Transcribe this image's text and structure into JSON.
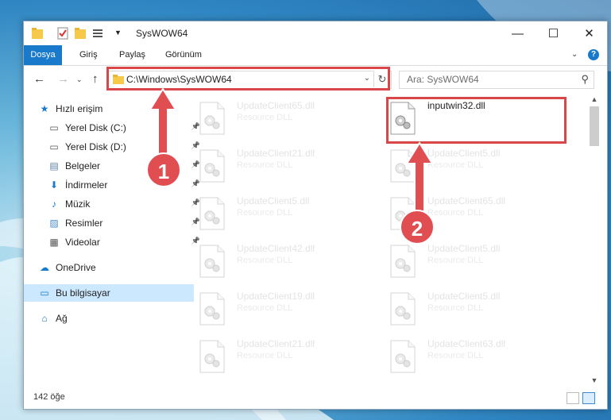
{
  "window": {
    "title": "SysWOW64"
  },
  "window_controls": {
    "minimize": "—",
    "maximize": "☐",
    "close": "✕"
  },
  "ribbon": {
    "tabs": [
      "Dosya",
      "Giriş",
      "Paylaş",
      "Görünüm"
    ],
    "help": "?"
  },
  "address": {
    "path": "C:\\Windows\\SysWOW64",
    "search_placeholder": "Ara: SysWOW64"
  },
  "nav": {
    "items": [
      {
        "label": "Hızlı erişim",
        "icon": "star-icon",
        "pinned": false
      },
      {
        "label": "Yerel Disk (C:)",
        "icon": "drive-icon",
        "pinned": true
      },
      {
        "label": "Yerel Disk (D:)",
        "icon": "drive-icon",
        "pinned": true
      },
      {
        "label": "Belgeler",
        "icon": "document-icon",
        "pinned": true
      },
      {
        "label": "İndirmeler",
        "icon": "download-icon",
        "pinned": true
      },
      {
        "label": "Müzik",
        "icon": "music-icon",
        "pinned": true
      },
      {
        "label": "Resimler",
        "icon": "pictures-icon",
        "pinned": true
      },
      {
        "label": "Videolar",
        "icon": "video-icon",
        "pinned": true
      },
      {
        "label": "OneDrive",
        "icon": "cloud-icon",
        "pinned": false
      },
      {
        "label": "Bu bilgisayar",
        "icon": "computer-icon",
        "pinned": false
      },
      {
        "label": "Ağ",
        "icon": "network-icon",
        "pinned": false
      }
    ]
  },
  "files": {
    "left": [
      {
        "name": "UpdateClient65.dll",
        "desc": "Resource DLL"
      },
      {
        "name": "UpdateClient21.dll",
        "desc": "Resource DLL"
      },
      {
        "name": "UpdateClient5.dll",
        "desc": "Resource DLL"
      },
      {
        "name": "UpdateClient42.dll",
        "desc": "Resource DLL"
      },
      {
        "name": "UpdateClient19.dll",
        "desc": "Resource DLL"
      },
      {
        "name": "UpdateClient21.dll",
        "desc": "Resource DLL"
      }
    ],
    "right": [
      {
        "name": "inputwin32.dll",
        "desc": ""
      },
      {
        "name": "UpdateClient5.dll",
        "desc": "Resource DLL"
      },
      {
        "name": "UpdateClient65.dll",
        "desc": "Resource DLL"
      },
      {
        "name": "UpdateClient5.dll",
        "desc": "Resource DLL"
      },
      {
        "name": "UpdateClient5.dll",
        "desc": "Resource DLL"
      },
      {
        "name": "UpdateClient63.dll",
        "desc": "Resource DLL"
      }
    ]
  },
  "status": {
    "count": "142 öğe"
  },
  "annotations": {
    "step1": "1",
    "step2": "2",
    "color": "#d9464a"
  }
}
